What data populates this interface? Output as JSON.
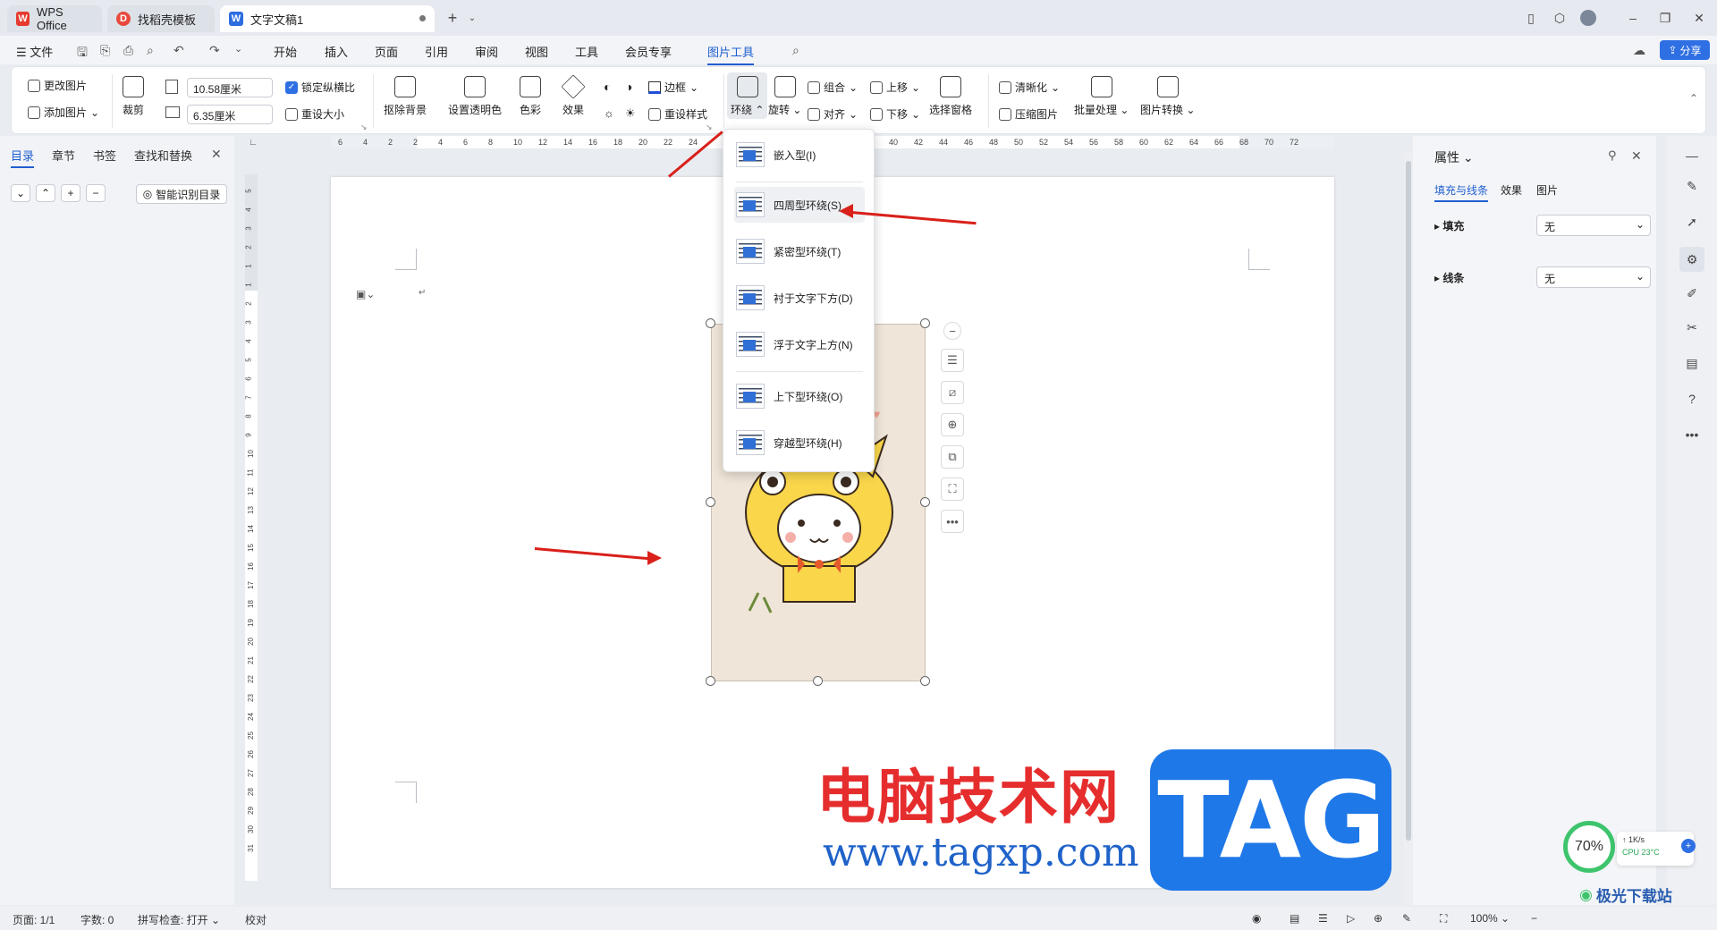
{
  "titlebar": {
    "tabs": [
      {
        "label": "WPS Office"
      },
      {
        "label": "找稻壳模板"
      },
      {
        "label": "文字文稿1"
      }
    ]
  },
  "menubar": {
    "file": "文件",
    "items": [
      "开始",
      "插入",
      "页面",
      "引用",
      "审阅",
      "视图",
      "工具",
      "会员专享",
      "图片工具"
    ],
    "share": "分享"
  },
  "ribbon": {
    "change_pic": "更改图片",
    "add_pic": "添加图片",
    "crop": "裁剪",
    "width_value": "10.58厘米",
    "height_value": "6.35厘米",
    "lock_ratio": "锁定纵横比",
    "reset_size": "重设大小",
    "remove_bg": "抠除背景",
    "set_transparent": "设置透明色",
    "color": "色彩",
    "effects": "效果",
    "border": "边框",
    "reset_style": "重设样式",
    "wrap": "环绕",
    "rotate": "旋转",
    "group": "组合",
    "align": "对齐",
    "bring_forward": "上移",
    "send_backward": "下移",
    "select_pane": "选择窗格",
    "sharpen": "清晰化",
    "compress": "压缩图片",
    "batch": "批量处理",
    "convert": "图片转换"
  },
  "wrap_menu": {
    "items": [
      {
        "label": "嵌入型(I)"
      },
      {
        "label": "四周型环绕(S)"
      },
      {
        "label": "紧密型环绕(T)"
      },
      {
        "label": "衬于文字下方(D)"
      },
      {
        "label": "浮于文字上方(N)"
      },
      {
        "label": "上下型环绕(O)"
      },
      {
        "label": "穿越型环绕(H)"
      }
    ]
  },
  "left_panel": {
    "tabs": [
      "目录",
      "章节",
      "书签",
      "查找和替换"
    ],
    "smart_toc": "智能识别目录"
  },
  "hruler_ticks": [
    "6",
    "4",
    "2",
    "2",
    "4",
    "6",
    "8",
    "10",
    "12",
    "14",
    "16",
    "18",
    "20",
    "22",
    "24",
    "",
    "",
    "",
    "",
    "",
    "",
    "38",
    "40",
    "42",
    "44",
    "46",
    "48",
    "50",
    "52",
    "54",
    "56",
    "58",
    "60",
    "62",
    "64",
    "66",
    "68",
    "70",
    "72"
  ],
  "vruler_ticks": [
    "5",
    "4",
    "3",
    "2",
    "1",
    "1",
    "2",
    "3",
    "4",
    "5",
    "6",
    "7",
    "8",
    "9",
    "10",
    "11",
    "12",
    "13",
    "14",
    "15",
    "16",
    "17",
    "18",
    "19",
    "20",
    "21",
    "22",
    "23",
    "24",
    "25",
    "26",
    "27",
    "28",
    "29",
    "30",
    "31"
  ],
  "right_panel": {
    "title": "属性",
    "tabs": [
      "填充与线条",
      "效果",
      "图片"
    ],
    "fill_label": "填充",
    "fill_value": "无",
    "line_label": "线条",
    "line_value": "无"
  },
  "statusbar": {
    "page": "页面: 1/1",
    "words": "字数: 0",
    "spell": "拼写检查: 打开",
    "proof": "校对",
    "zoom": "100%"
  },
  "watermark": {
    "red_text": "电脑技术网",
    "url": "www.tagxp.com",
    "tag": "TAG",
    "site": "极光下载站"
  },
  "widget": {
    "percent": "70%",
    "speed": "1K/s",
    "cpu": "CPU 23°C"
  }
}
